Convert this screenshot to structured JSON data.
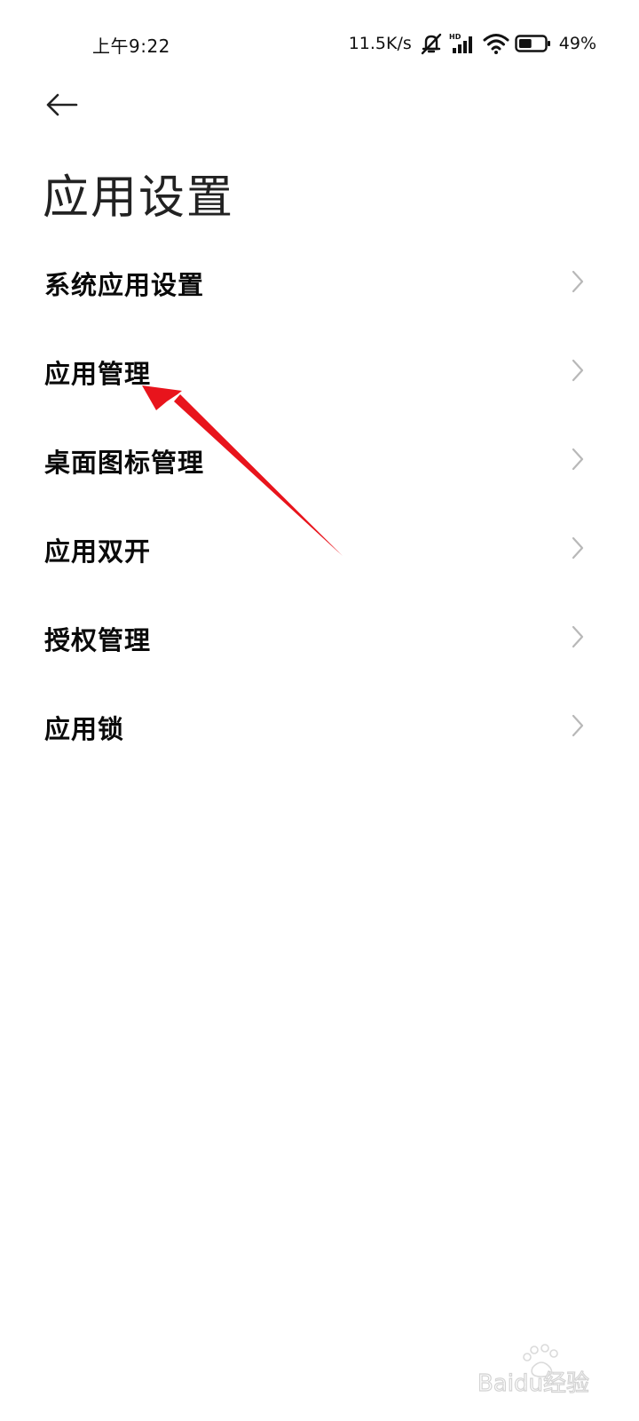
{
  "status_bar": {
    "time": "上午9:22",
    "net_speed": "11.5K/s",
    "battery_percent": "49%",
    "icons": [
      "mute-bell-icon",
      "hd-signal-icon",
      "wifi-icon",
      "battery-icon"
    ],
    "battery_level": 0.49
  },
  "header": {
    "back_icon": "back-arrow-icon",
    "title": "应用设置"
  },
  "menu": {
    "items": [
      {
        "label": "系统应用设置"
      },
      {
        "label": "应用管理"
      },
      {
        "label": "桌面图标管理"
      },
      {
        "label": "应用双开"
      },
      {
        "label": "授权管理"
      },
      {
        "label": "应用锁"
      }
    ]
  },
  "annotation": {
    "color": "#e8141c",
    "points_to": "应用管理"
  },
  "watermark": {
    "text": "Baidu经验"
  },
  "colors": {
    "background": "#ffffff",
    "text": "#0a0a0a",
    "chevron": "#b8b8b8"
  }
}
